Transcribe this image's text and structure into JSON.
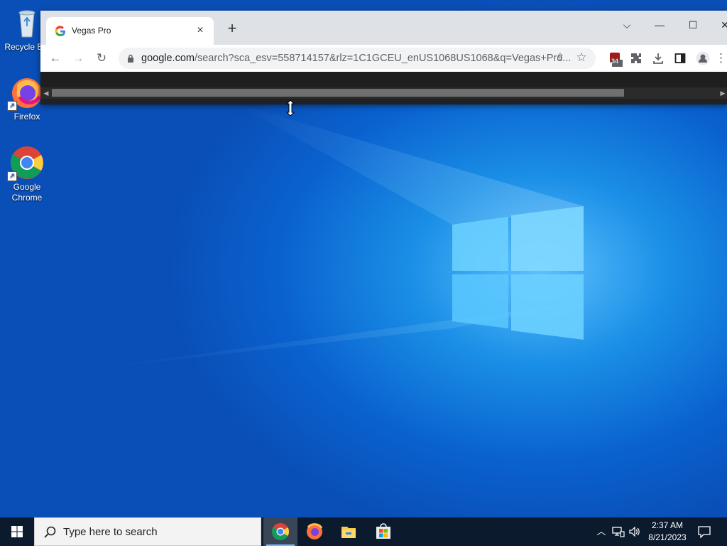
{
  "desktop": {
    "icons": [
      {
        "label": "Recycle Bin",
        "icon": "recycle-bin-icon"
      },
      {
        "label": "Firefox",
        "icon": "firefox-icon"
      },
      {
        "label": "Google Chrome",
        "icon": "chrome-icon"
      }
    ]
  },
  "browser": {
    "tab": {
      "title": "Vegas Pro",
      "favicon": "google-g-icon"
    },
    "new_tab_label": "+",
    "window_controls": {
      "tablist": "⌵",
      "minimize": "—",
      "maximize": "☐",
      "close": "✕"
    },
    "toolbar": {
      "back": "←",
      "forward": "→",
      "reload": "↻",
      "url_host": "google.com",
      "url_path": "/search?sca_esv=558714157&rlz=1C1GCEU_enUS1068US1068&q=Vegas+Pro...",
      "extension_badge": "34"
    }
  },
  "taskbar": {
    "search_placeholder": "Type here to search",
    "pinned": [
      "chrome-icon",
      "firefox-icon",
      "file-explorer-icon",
      "microsoft-store-icon"
    ],
    "clock_time": "2:37 AM",
    "clock_date": "8/21/2023"
  },
  "colors": {
    "desktop_blue": "#0a62cf",
    "taskbar": "#0c1a2e",
    "chrome_frame": "#dee1e6"
  }
}
